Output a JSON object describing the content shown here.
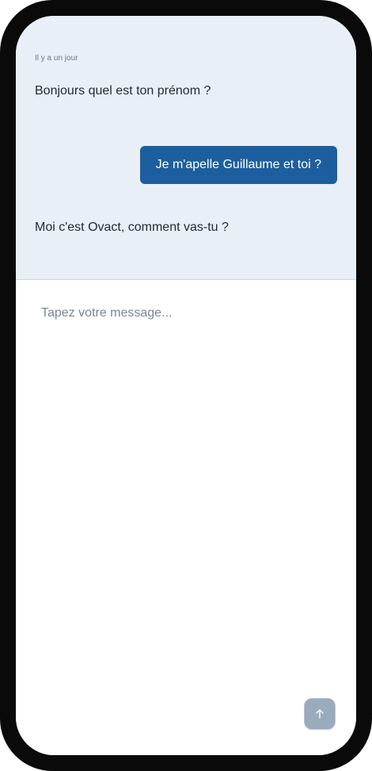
{
  "chat": {
    "timestamp": "Il y a un jour",
    "messages": [
      {
        "from": "bot",
        "text": "Bonjours quel est ton prénom ?"
      },
      {
        "from": "user",
        "text": "Je m'apelle Guillaume et toi ?"
      },
      {
        "from": "bot",
        "text": "Moi c'est Ovact, comment vas-tu ?"
      }
    ]
  },
  "composer": {
    "placeholder": "Tapez votre message...",
    "value": "",
    "send_icon": "arrow-up-icon"
  },
  "colors": {
    "chat_background": "#e8eff7",
    "user_bubble": "#1d5f9e",
    "send_button": "#9aabbd"
  }
}
